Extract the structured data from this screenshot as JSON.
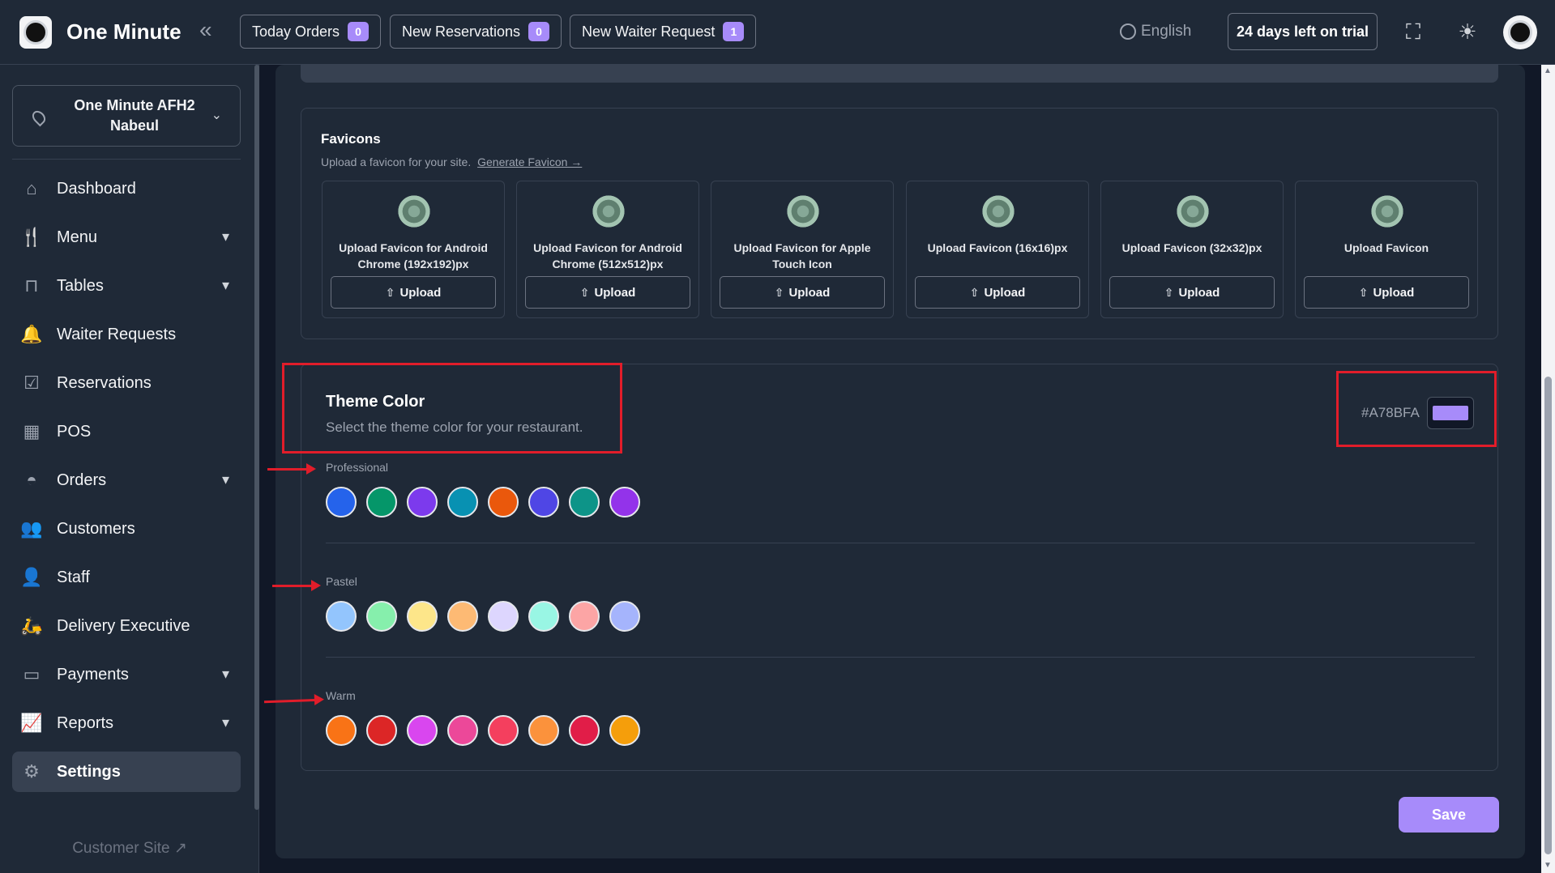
{
  "app": {
    "title": "One Minute"
  },
  "header": {
    "pills": [
      {
        "label": "Today Orders",
        "count": "0"
      },
      {
        "label": "New Reservations",
        "count": "0"
      },
      {
        "label": "New Waiter Request",
        "count": "1"
      }
    ],
    "language": "English",
    "trial": "24 days left on trial"
  },
  "sidebar": {
    "branch": "One Minute AFH2 Nabeul",
    "items": [
      {
        "label": "Dashboard",
        "icon": "home-icon"
      },
      {
        "label": "Menu",
        "icon": "menu-icon"
      },
      {
        "label": "Tables",
        "icon": "table-icon"
      },
      {
        "label": "Waiter Requests",
        "icon": "bell-icon"
      },
      {
        "label": "Reservations",
        "icon": "calendar-check-icon"
      },
      {
        "label": "POS",
        "icon": "pos-icon"
      },
      {
        "label": "Orders",
        "icon": "cloche-icon"
      },
      {
        "label": "Customers",
        "icon": "users-icon"
      },
      {
        "label": "Staff",
        "icon": "staff-icon"
      },
      {
        "label": "Delivery Executive",
        "icon": "scooter-icon"
      },
      {
        "label": "Payments",
        "icon": "wallet-icon"
      },
      {
        "label": "Reports",
        "icon": "chart-icon"
      },
      {
        "label": "Settings",
        "icon": "gear-icon"
      }
    ],
    "customer_site": "Customer Site"
  },
  "favicons": {
    "title": "Favicons",
    "subtitle": "Upload a favicon for your site.",
    "link": "Generate Favicon →",
    "upload_label": "Upload",
    "items": [
      "Upload Favicon for Android Chrome (192x192)px",
      "Upload Favicon for Android Chrome (512x512)px",
      "Upload Favicon for Apple Touch Icon",
      "Upload Favicon (16x16)px",
      "Upload Favicon (32x32)px",
      "Upload Favicon"
    ]
  },
  "theme": {
    "title": "Theme Color",
    "subtitle": "Select the theme color for your restaurant.",
    "current": "#A78BFA",
    "groups": [
      {
        "label": "Professional",
        "colors": [
          "#2563eb",
          "#059669",
          "#7c3aed",
          "#0891b2",
          "#ea580c",
          "#4f46e5",
          "#0d9488",
          "#9333ea"
        ]
      },
      {
        "label": "Pastel",
        "colors": [
          "#93c5fd",
          "#86efac",
          "#fde68a",
          "#fdba74",
          "#ddd6fe",
          "#99f6e4",
          "#fca5a5",
          "#a5b4fc"
        ]
      },
      {
        "label": "Warm",
        "colors": [
          "#f97316",
          "#dc2626",
          "#d946ef",
          "#ec4899",
          "#f43f5e",
          "#fb923c",
          "#e11d48",
          "#f59e0b"
        ]
      }
    ]
  },
  "actions": {
    "save": "Save"
  }
}
